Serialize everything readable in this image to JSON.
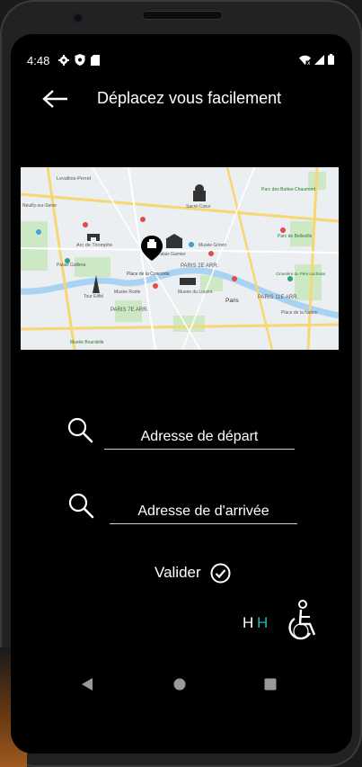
{
  "status_bar": {
    "time": "4:48",
    "left_icons": [
      "gear-icon",
      "shield-icon",
      "sd-card-icon"
    ],
    "right_icons": [
      "wifi-icon",
      "signal-icon",
      "battery-icon"
    ]
  },
  "header": {
    "title": "Déplacez vous facilement"
  },
  "map": {
    "labels": {
      "levallois": "Levallois-Perret",
      "neuilly": "Neuilly-sur-Seine",
      "arc": "Arc de Triomphe",
      "pasteur": "Palais Garnier",
      "paris2": "PARIS 2E ARR.",
      "concorde": "Place de la Concorde",
      "louvre": "Musée du Louvre",
      "paris": "Paris",
      "eiffel": "Tour Eiffel",
      "paris7": "PARIS 7E ARR.",
      "paris11": "PARIS 11E ARR.",
      "sacre": "Sacré-Cœur",
      "bourdelle": "Musée Bourdelle",
      "rodin": "Musée Rodin",
      "grevin": "Musée Grévin",
      "belleville": "Parc de Belleville",
      "pere": "Cimetière du Père Lachaise",
      "galliera": "Palais Galliera",
      "nation": "Place de la Nation",
      "buttes": "Parc des Buttes-Chaumont"
    }
  },
  "departure": {
    "placeholder": "Adresse de départ"
  },
  "arrival": {
    "placeholder": "Adresse de d'arrivée"
  },
  "validate": {
    "label": "Valider"
  },
  "toggles": {
    "h_white": "H",
    "h_teal": "H"
  },
  "colors": {
    "accent_teal": "#19b8b8",
    "background": "#000000",
    "text": "#ffffff"
  },
  "nav_bar": {
    "buttons": [
      "back-triangle-icon",
      "home-circle-icon",
      "recents-square-icon"
    ]
  }
}
